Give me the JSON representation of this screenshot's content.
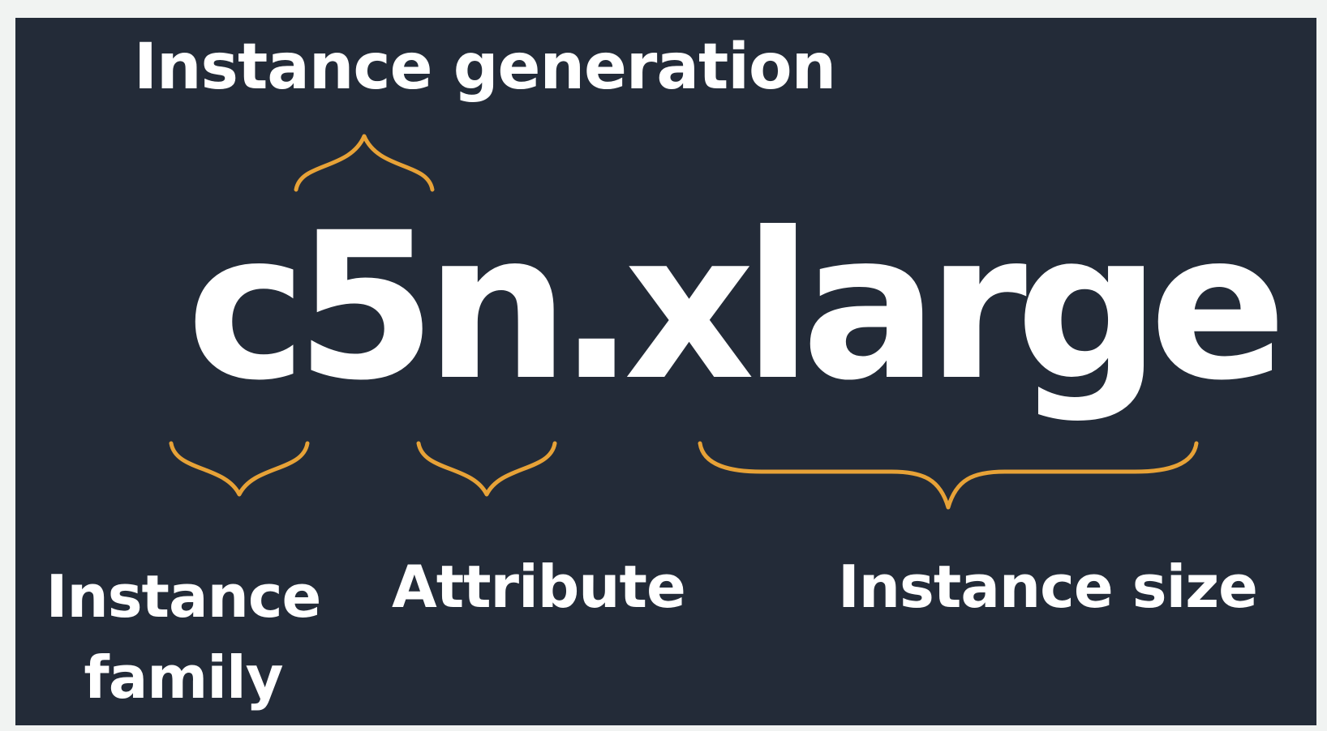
{
  "instance_type": "c5n.xlarge",
  "labels": {
    "generation": "Instance generation",
    "family": "Instance family",
    "attribute": "Attribute",
    "size": "Instance size"
  },
  "colors": {
    "background": "#232b38",
    "text": "#ffffff",
    "brace": "#e7a237",
    "page": "#f1f3f2"
  }
}
